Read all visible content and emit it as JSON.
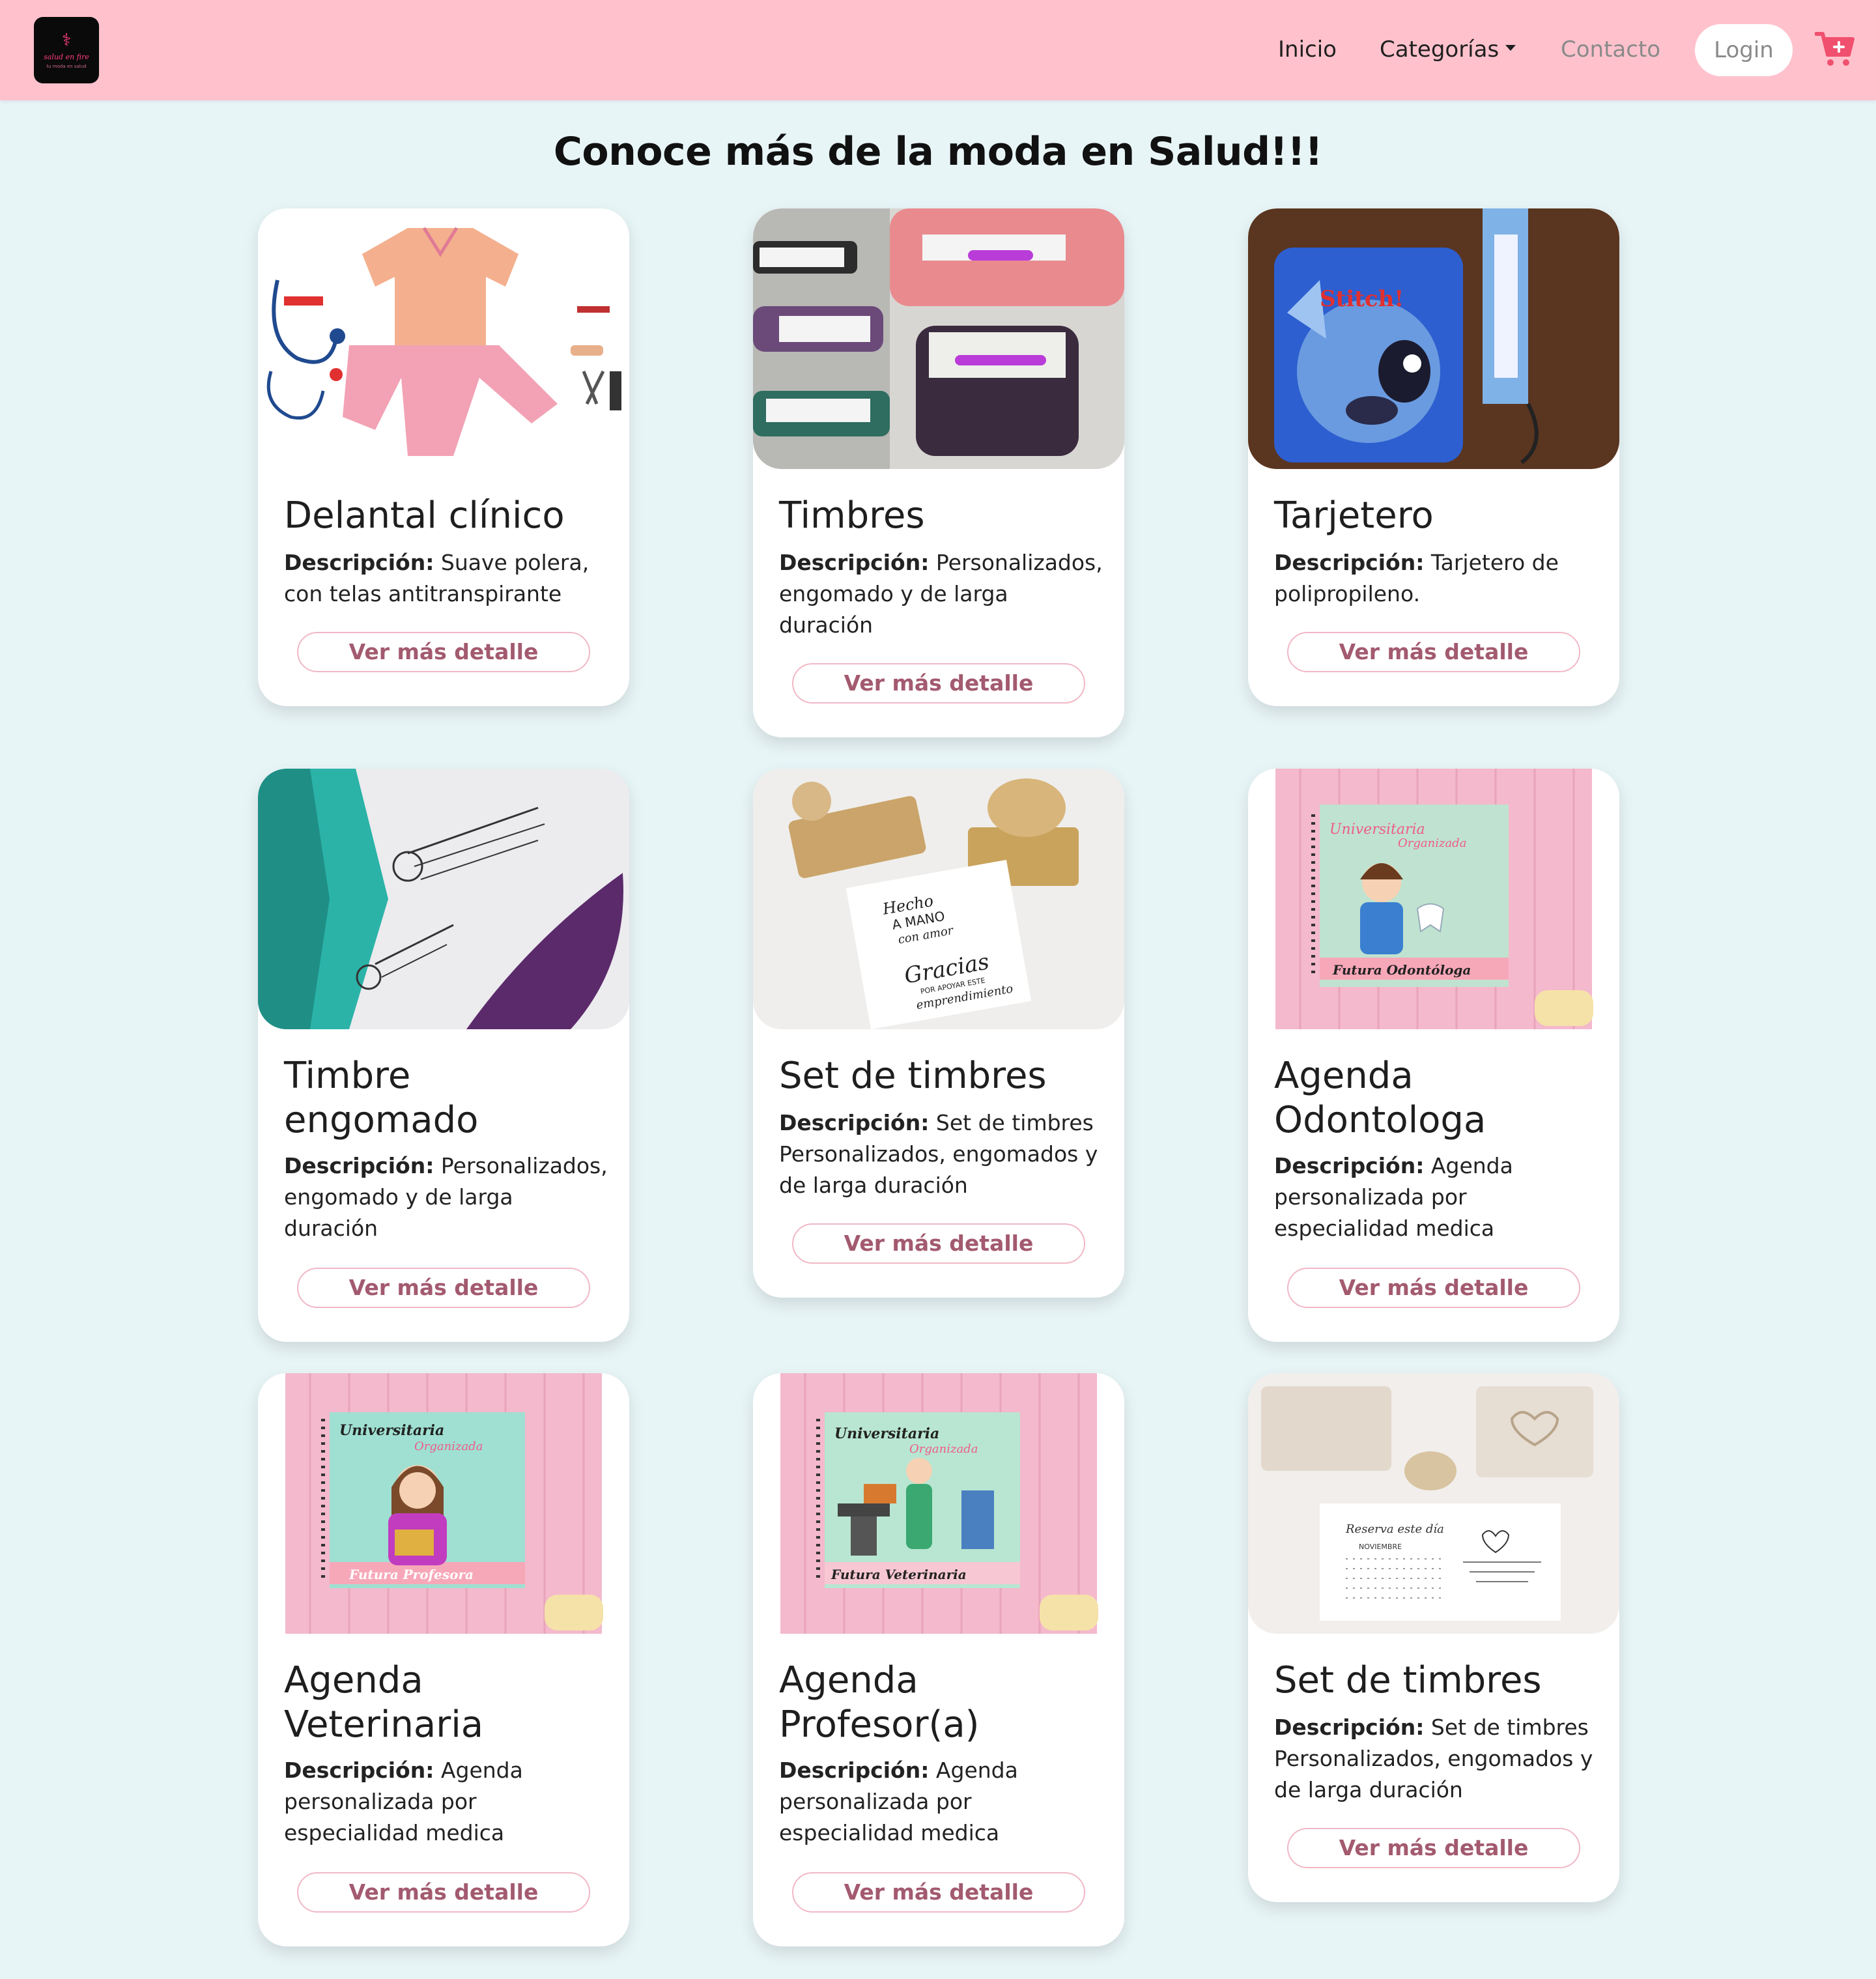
{
  "nav": {
    "logo_text": "salud en fire",
    "logo_sub": "tu moda en salud",
    "inicio": "Inicio",
    "categorias": "Categorías",
    "contacto": "Contacto",
    "login": "Login",
    "cart_icon": "cart-plus-icon"
  },
  "page_title": "Conoce más de la moda en Salud!!!",
  "desc_label": "Descripción:",
  "products": [
    {
      "title": "Delantal clínico",
      "desc": "Suave polera, con telas antitranspirante",
      "button": "Ver más detalle"
    },
    {
      "title": "Timbres",
      "desc": "Personalizados, engomado y de larga duración",
      "button": "Ver más detalle"
    },
    {
      "title": "Tarjetero",
      "desc": "Tarjetero de polipropileno.",
      "button": "Ver más detalle"
    },
    {
      "title": "Timbre engomado",
      "desc": "Personalizados, engomado y de larga duración",
      "button": "Ver más detalle"
    },
    {
      "title": "Set de timbres",
      "desc": "Set de timbres Personalizados, engomados y de larga duración",
      "button": "Ver más detalle"
    },
    {
      "title": "Agenda Odontologa",
      "desc": "Agenda personalizada por especialidad medica",
      "button": "Ver más detalle"
    },
    {
      "title": "Agenda Veterinaria",
      "desc": "Agenda personalizada por especialidad medica",
      "button": "Ver más detalle"
    },
    {
      "title": "Agenda Profesor(a)",
      "desc": "Agenda personalizada por especialidad medica",
      "button": "Ver más detalle"
    },
    {
      "title": "Set de timbres",
      "desc": "Set de timbres Personalizados, engomados y de larga duración",
      "button": "Ver más detalle"
    }
  ],
  "image_text": {
    "stitch": "Stitch!",
    "hecho": "Hecho",
    "a_mano": "A MANO",
    "con_amor": "con amor",
    "gracias": "Gracias",
    "por_apoyar": "POR APOYAR ESTE",
    "emprendimiento": "emprendimiento",
    "universitaria": "Universitaria",
    "organizada": "Organizada",
    "futura_odontologa": "Futura Odontóloga",
    "futura_profesora": "Futura Profesora",
    "futura_veterinaria": "Futura Veterinaria",
    "reserva": "Reserva este día",
    "noviembre": "NOVIEMBRE"
  },
  "colors": {
    "navbar": "#ffc2cd",
    "background": "#e8f5f7",
    "button_text": "#a35a6f",
    "cart": "#f0506e"
  }
}
